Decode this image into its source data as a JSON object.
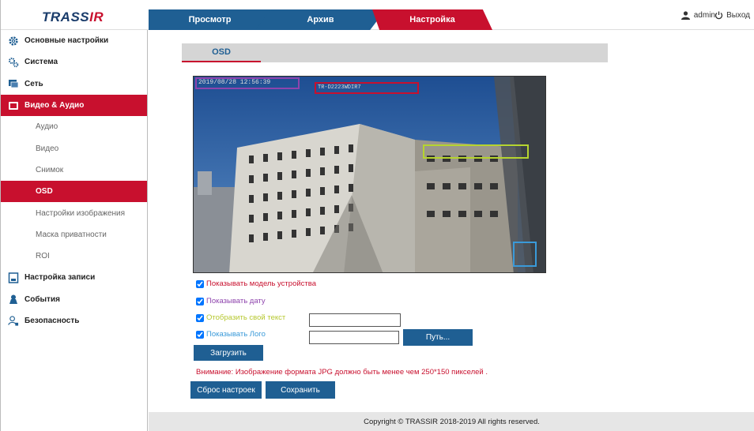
{
  "header": {
    "logo": "TRASSIR",
    "tabs": [
      {
        "label": "Просмотр"
      },
      {
        "label": "Архив"
      },
      {
        "label": "Настройка"
      }
    ],
    "user": "admin",
    "logout": "Выход"
  },
  "sidebar": {
    "items": [
      {
        "label": "Основные настройки",
        "icon": "gear-icon"
      },
      {
        "label": "Система",
        "icon": "gears-icon"
      },
      {
        "label": "Сеть",
        "icon": "network-icon"
      },
      {
        "label": "Видео & Аудио",
        "icon": "video-icon"
      },
      {
        "label": "Аудио"
      },
      {
        "label": "Видео"
      },
      {
        "label": "Снимок"
      },
      {
        "label": "OSD"
      },
      {
        "label": "Настройки изображения"
      },
      {
        "label": "Маска приватности"
      },
      {
        "label": "ROI"
      },
      {
        "label": "Настройка записи",
        "icon": "storage-icon"
      },
      {
        "label": "События",
        "icon": "event-icon"
      },
      {
        "label": "Безопасность",
        "icon": "user-lock-icon"
      }
    ]
  },
  "main": {
    "tab": "OSD",
    "preview": {
      "date_overlay": "2019/08/28 12:56:39",
      "model_overlay": "TR-D2223WDIR7"
    },
    "options": {
      "show_model": "Показывать модель устройства",
      "show_date": "Показывать дату",
      "show_text": "Отобразить свой текст",
      "show_logo": "Показывать Лого"
    },
    "custom_text_value": "",
    "logo_path_value": "",
    "path_button": "Путь...",
    "upload_button": "Загрузить",
    "warning": "Внимание: Изображение формата JPG должно быть менее чем 250*150 пикселей .",
    "reset_button": "Сброс настроек",
    "save_button": "Сохранить"
  },
  "footer": {
    "copyright": "Copyright © TRASSIR 2018-2019 All rights reserved."
  },
  "colors": {
    "accent_blue": "#1f5f93",
    "accent_red": "#c8102e",
    "date_color": "#8e44ad",
    "text_color": "#b6c82f",
    "logo_color": "#3a9ad9"
  }
}
